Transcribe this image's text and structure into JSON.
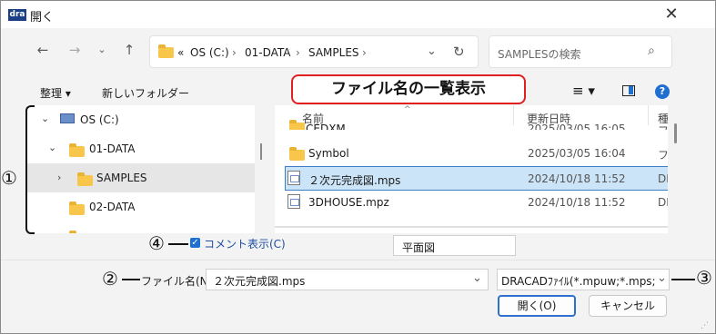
{
  "window": {
    "logo": "dra",
    "title": "開く",
    "close_icon": "close-icon"
  },
  "nav": {
    "back_icon": "arrow-left-icon",
    "forward_icon": "arrow-right-icon",
    "recent_icon": "chevron-down-icon",
    "up_icon": "arrow-up-icon"
  },
  "address": {
    "overflow": "«",
    "crumbs": [
      "OS (C:)",
      "01-DATA",
      "SAMPLES"
    ],
    "separator": "›"
  },
  "search": {
    "placeholder": "SAMPLESの検索"
  },
  "toolbar": {
    "organize": "整理 ▾",
    "new_folder": "新しいフォルダー"
  },
  "callout": {
    "text": "ファイル名の一覧表示"
  },
  "tree": {
    "items": [
      {
        "label": "OS (C:)",
        "expanded": true
      },
      {
        "label": "01-DATA",
        "expanded": true
      },
      {
        "label": "SAMPLES",
        "selected": true
      },
      {
        "label": "02-DATA"
      }
    ]
  },
  "files": {
    "headers": {
      "name": "名前",
      "date": "更新日時",
      "type": "種"
    },
    "rows": [
      {
        "name": "CEDXM",
        "date": "2025/03/05 16:05",
        "type": "フ"
      },
      {
        "name": "Symbol",
        "date": "2025/03/05 16:04",
        "type": "フ"
      },
      {
        "name": "２次元完成図.mps",
        "date": "2024/10/18 11:52",
        "type": "DR",
        "selected": true
      },
      {
        "name": "3DHOUSE.mpz",
        "date": "2024/10/18 11:52",
        "type": "DR"
      }
    ]
  },
  "comment": {
    "checkbox_label": "コメント表示(C)",
    "checked": true,
    "preview_value": "平面図"
  },
  "filename": {
    "label": "ファイル名(N):",
    "value": "２次元完成図.mps"
  },
  "filetype": {
    "value": "DRACADﾌｧｲﾙ(*.mpuw;*.mps;*.r"
  },
  "buttons": {
    "open": "開く(O)",
    "cancel": "キャンセル"
  },
  "markers": [
    "①",
    "②",
    "③",
    "④"
  ],
  "colors": {
    "accent": "#2f6fd0",
    "callout_border": "#e02020",
    "selection": "#cce4f7"
  }
}
